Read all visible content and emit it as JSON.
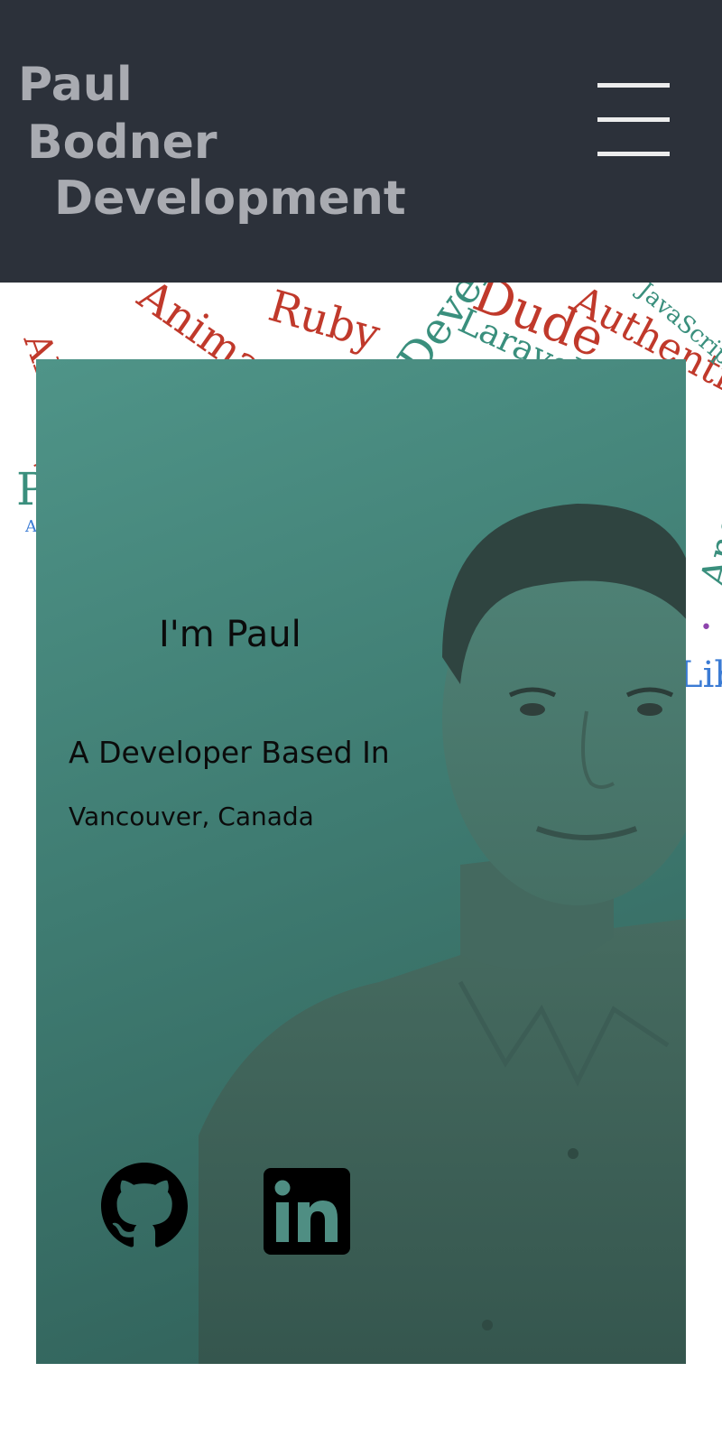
{
  "header": {
    "brand": {
      "line1": "Paul",
      "line2": "Bodner",
      "line3": "Development"
    },
    "menu_icon": "hamburger-menu-icon"
  },
  "word_cloud": [
    "Ruby",
    "Authentication",
    "Dude",
    "Laravel",
    "JavaScript",
    "Developer",
    "Angular",
    "Animation",
    "API",
    "Libraries"
  ],
  "hero": {
    "greeting": "I'm Paul",
    "role": "A Developer Based In",
    "location": "Vancouver, Canada"
  },
  "social": [
    {
      "icon": "github-icon"
    },
    {
      "icon": "linkedin-icon"
    }
  ],
  "colors": {
    "header_bg": "#2c313a",
    "brand_text": "#a9abb1",
    "card_top": "#4f9488",
    "card_bottom": "#2f5d56",
    "cloud_red": "#c0392b",
    "cloud_teal": "#3a8f7d",
    "cloud_blue": "#3b7bd4",
    "cloud_purple": "#8e44ad"
  }
}
